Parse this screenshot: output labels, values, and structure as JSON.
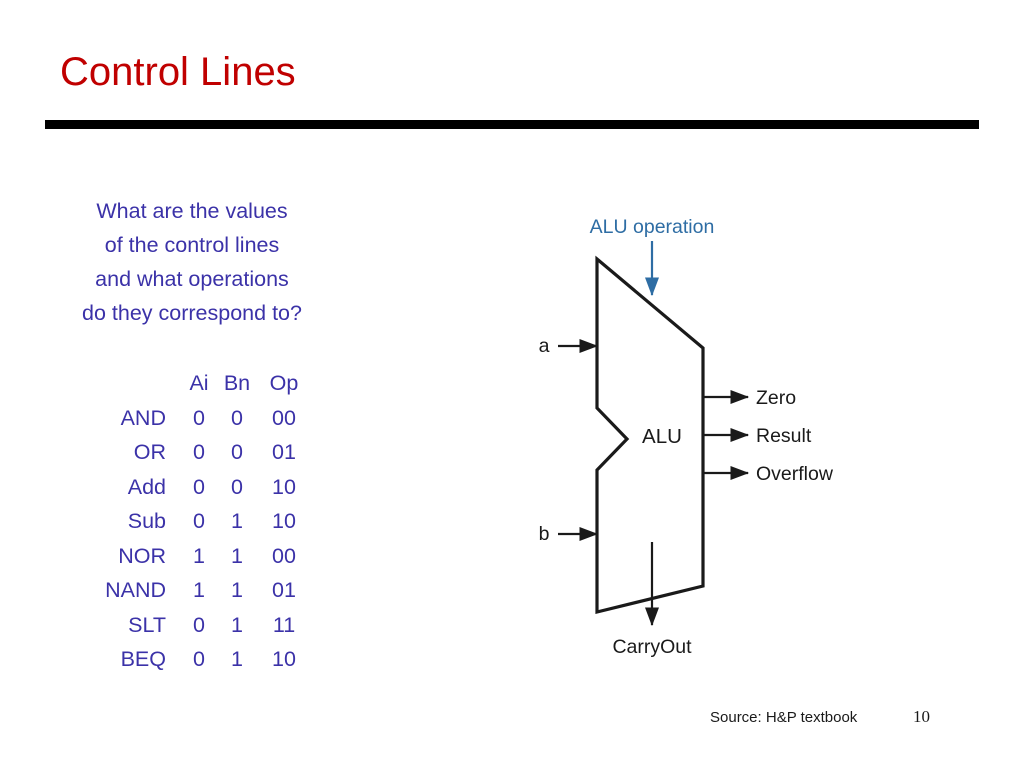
{
  "slide": {
    "title": "Control Lines",
    "title_color": "#C00000",
    "accent_blue": "#3B32A8",
    "figure_label_blue": "#2E6DA4"
  },
  "question": {
    "lines": [
      "What are the values",
      "of the control lines",
      "and what operations",
      "do they correspond to?"
    ]
  },
  "control_table": {
    "headers": [
      "",
      "Ai",
      "Bn",
      "Op"
    ],
    "rows": [
      {
        "op": "AND",
        "ai": "0",
        "bn": "0",
        "opcode": "00"
      },
      {
        "op": "OR",
        "ai": "0",
        "bn": "0",
        "opcode": "01"
      },
      {
        "op": "Add",
        "ai": "0",
        "bn": "0",
        "opcode": "10"
      },
      {
        "op": "Sub",
        "ai": "0",
        "bn": "1",
        "opcode": "10"
      },
      {
        "op": "NOR",
        "ai": "1",
        "bn": "1",
        "opcode": "00"
      },
      {
        "op": "NAND",
        "ai": "1",
        "bn": "1",
        "opcode": "01"
      },
      {
        "op": "SLT",
        "ai": "0",
        "bn": "1",
        "opcode": "11"
      },
      {
        "op": "BEQ",
        "ai": "0",
        "bn": "1",
        "opcode": "10"
      }
    ]
  },
  "alu_diagram": {
    "control_label": "ALU operation",
    "body_label": "ALU",
    "input_a": "a",
    "input_b": "b",
    "output_zero": "Zero",
    "output_result": "Result",
    "output_overflow": "Overflow",
    "output_carryout": "CarryOut"
  },
  "footer": {
    "source": "Source: H&P textbook",
    "page_number": "10"
  }
}
